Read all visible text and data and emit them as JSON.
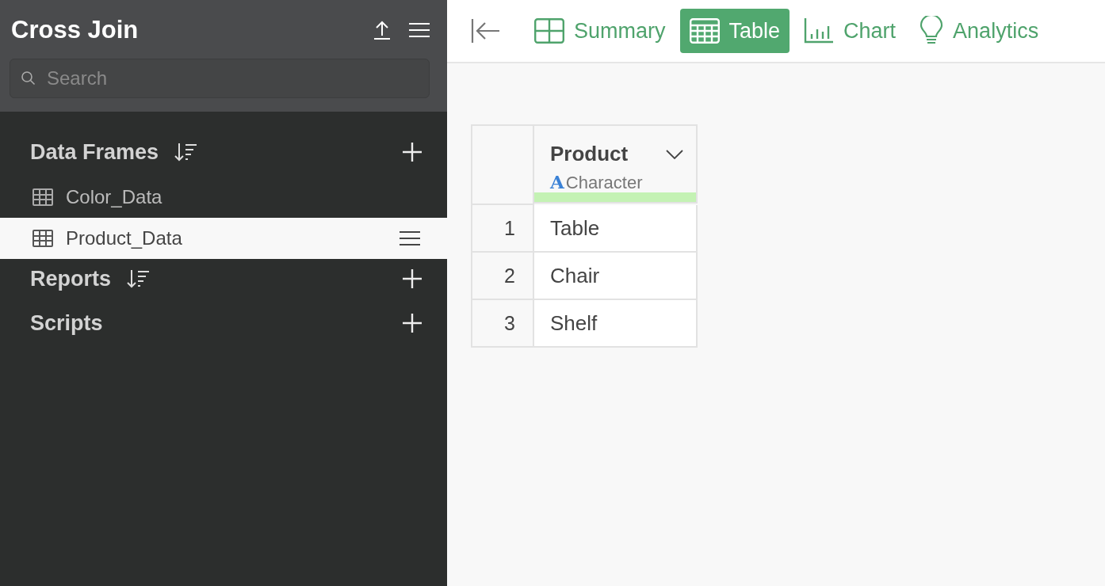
{
  "sidebar": {
    "title": "Cross Join",
    "search": {
      "placeholder": "Search"
    },
    "sections": [
      {
        "title": "Data Frames",
        "sortable": true,
        "items": [
          {
            "label": "Color_Data",
            "selected": false
          },
          {
            "label": "Product_Data",
            "selected": true
          }
        ]
      },
      {
        "title": "Reports",
        "sortable": true
      },
      {
        "title": "Scripts",
        "sortable": false
      }
    ]
  },
  "tabs": [
    {
      "kind": "summary",
      "label": "Summary",
      "selected": false
    },
    {
      "kind": "table",
      "label": "Table",
      "selected": true
    },
    {
      "kind": "chart",
      "label": "Chart",
      "selected": false
    },
    {
      "kind": "analytics",
      "label": "Analytics",
      "selected": false
    }
  ],
  "table": {
    "columns": [
      {
        "name": "Product",
        "type_mark": "A",
        "type": "Character"
      }
    ],
    "rows": [
      {
        "number": "1",
        "cells": [
          "Table"
        ]
      },
      {
        "number": "2",
        "cells": [
          "Chair"
        ]
      },
      {
        "number": "3",
        "cells": [
          "Shelf"
        ]
      }
    ]
  }
}
